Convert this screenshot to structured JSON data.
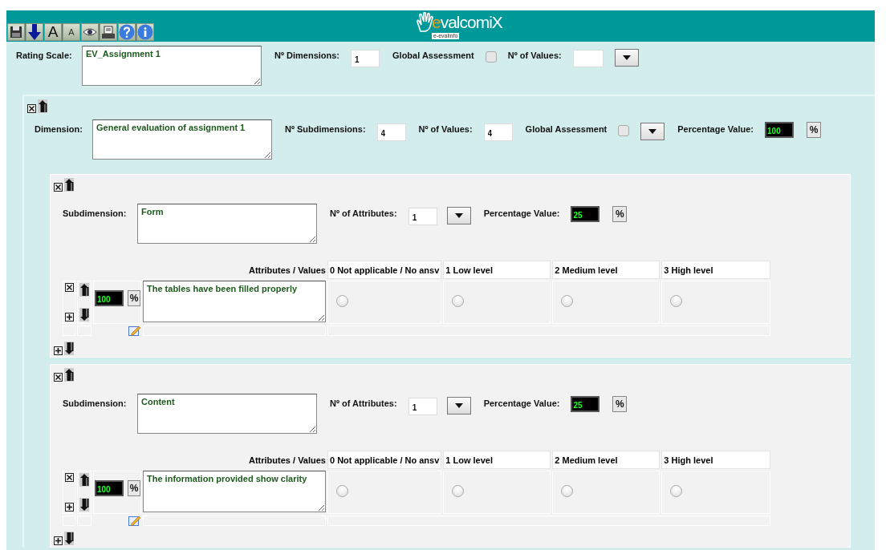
{
  "toolbar": [
    {
      "kind": "save"
    },
    {
      "kind": "download"
    },
    {
      "kind": "font-larger",
      "label": "A"
    },
    {
      "kind": "font-smaller",
      "label": "A"
    },
    {
      "kind": "view"
    },
    {
      "kind": "print"
    },
    {
      "kind": "help"
    },
    {
      "kind": "info"
    }
  ],
  "logo": {
    "accent": "e",
    "name": "valcomiX",
    "tagline": "e-evalinfo"
  },
  "rating_scale": {
    "label": "Rating Scale:",
    "value": "EV_Assignment 1",
    "dimensions_label": "Nº Dimensions:",
    "dimensions": "1",
    "global_label": "Global Assessment",
    "global_checked": false,
    "values_label": "Nº of Values:"
  },
  "dimension": {
    "label": "Dimension:",
    "value": "General evaluation of assignment 1",
    "subdimensions_label": "Nº Subdimensions:",
    "subdimensions_count": "4",
    "values_label": "Nº of Values:",
    "values": "4",
    "global_label": "Global Assessment",
    "global_checked": false,
    "percentage_label": "Percentage Value:",
    "percentage": "100",
    "percent_button": "%",
    "subdimensions": [
      {
        "label": "Subdimension:",
        "value": "Form",
        "attributes_label": "Nº of Attributes:",
        "attributes_count": "1",
        "percentage_label": "Percentage Value:",
        "percentage": "25",
        "percent_button": "%",
        "table_label": "Attributes / Values",
        "columns": [
          "0 Not applicable / No ansv",
          "1 Low level",
          "2 Medium level",
          "3 High level"
        ],
        "attributes": [
          {
            "percentage": "100",
            "percent_button": "%",
            "text": "The tables have been filled properly",
            "ratings": [
              {
                "selected": false
              },
              {
                "selected": false
              },
              {
                "selected": false
              },
              {
                "selected": false
              }
            ]
          }
        ]
      },
      {
        "label": "Subdimension:",
        "value": "Content",
        "attributes_label": "Nº of Attributes:",
        "attributes_count": "1",
        "percentage_label": "Percentage Value:",
        "percentage": "25",
        "percent_button": "%",
        "table_label": "Attributes / Values",
        "columns": [
          "0 Not applicable / No ansv",
          "1 Low level",
          "2 Medium level",
          "3 High level"
        ],
        "attributes": [
          {
            "percentage": "100",
            "percent_button": "%",
            "text": "The information provided show clarity",
            "ratings": [
              {
                "selected": false
              },
              {
                "selected": false
              },
              {
                "selected": false
              },
              {
                "selected": false
              }
            ]
          }
        ]
      }
    ]
  }
}
